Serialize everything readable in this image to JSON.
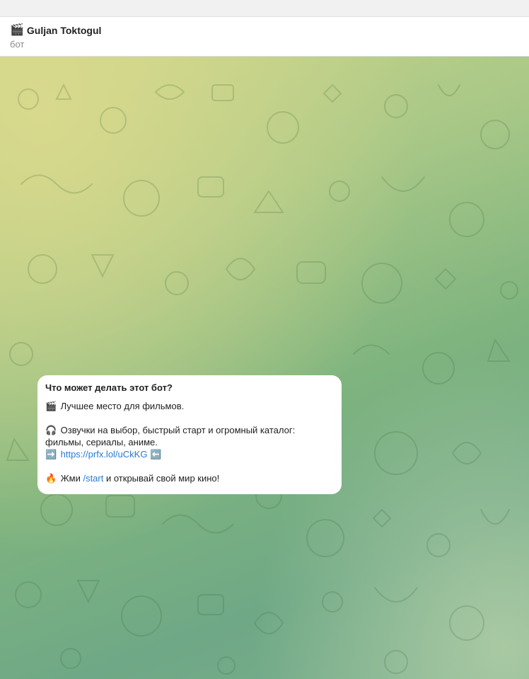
{
  "header": {
    "title_emoji": "🎬",
    "title": "Guljan Toktogul",
    "subtitle": "бот"
  },
  "message": {
    "heading": "Что может делать этот бот?",
    "line1_emoji": "🎬",
    "line1_text": "Лучшее место для фильмов.",
    "line2_emoji": "🎧",
    "line2_text": "Озвучки на выбор, быстрый старт и огромный каталог:",
    "line3_text": "фильмы, сериалы, аниме.",
    "arrow_right": "➡️",
    "link": "https://prfx.lol/uCkKG",
    "arrow_left": "⬅️",
    "line5_emoji": "🔥",
    "line5_before": "Жми",
    "line5_command": "/start",
    "line5_after": "и открывай свой мир кино!"
  },
  "colors": {
    "link": "#2a7bd0",
    "header_bg": "#ffffff",
    "bubble_bg": "#ffffff"
  }
}
